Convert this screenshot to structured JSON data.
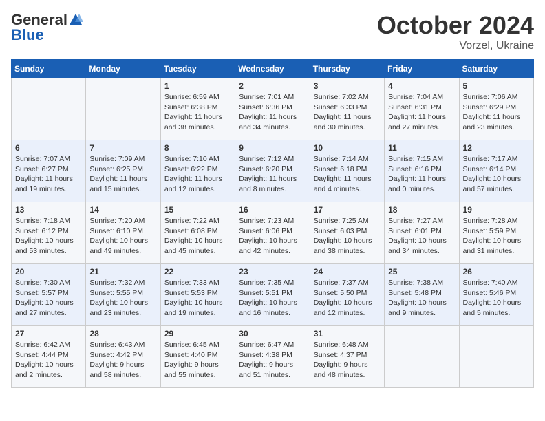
{
  "header": {
    "logo_general": "General",
    "logo_blue": "Blue",
    "month_title": "October 2024",
    "location": "Vorzel, Ukraine"
  },
  "weekdays": [
    "Sunday",
    "Monday",
    "Tuesday",
    "Wednesday",
    "Thursday",
    "Friday",
    "Saturday"
  ],
  "weeks": [
    [
      {
        "day": "",
        "info": ""
      },
      {
        "day": "",
        "info": ""
      },
      {
        "day": "1",
        "info": "Sunrise: 6:59 AM\nSunset: 6:38 PM\nDaylight: 11 hours and 38 minutes."
      },
      {
        "day": "2",
        "info": "Sunrise: 7:01 AM\nSunset: 6:36 PM\nDaylight: 11 hours and 34 minutes."
      },
      {
        "day": "3",
        "info": "Sunrise: 7:02 AM\nSunset: 6:33 PM\nDaylight: 11 hours and 30 minutes."
      },
      {
        "day": "4",
        "info": "Sunrise: 7:04 AM\nSunset: 6:31 PM\nDaylight: 11 hours and 27 minutes."
      },
      {
        "day": "5",
        "info": "Sunrise: 7:06 AM\nSunset: 6:29 PM\nDaylight: 11 hours and 23 minutes."
      }
    ],
    [
      {
        "day": "6",
        "info": "Sunrise: 7:07 AM\nSunset: 6:27 PM\nDaylight: 11 hours and 19 minutes."
      },
      {
        "day": "7",
        "info": "Sunrise: 7:09 AM\nSunset: 6:25 PM\nDaylight: 11 hours and 15 minutes."
      },
      {
        "day": "8",
        "info": "Sunrise: 7:10 AM\nSunset: 6:22 PM\nDaylight: 11 hours and 12 minutes."
      },
      {
        "day": "9",
        "info": "Sunrise: 7:12 AM\nSunset: 6:20 PM\nDaylight: 11 hours and 8 minutes."
      },
      {
        "day": "10",
        "info": "Sunrise: 7:14 AM\nSunset: 6:18 PM\nDaylight: 11 hours and 4 minutes."
      },
      {
        "day": "11",
        "info": "Sunrise: 7:15 AM\nSunset: 6:16 PM\nDaylight: 11 hours and 0 minutes."
      },
      {
        "day": "12",
        "info": "Sunrise: 7:17 AM\nSunset: 6:14 PM\nDaylight: 10 hours and 57 minutes."
      }
    ],
    [
      {
        "day": "13",
        "info": "Sunrise: 7:18 AM\nSunset: 6:12 PM\nDaylight: 10 hours and 53 minutes."
      },
      {
        "day": "14",
        "info": "Sunrise: 7:20 AM\nSunset: 6:10 PM\nDaylight: 10 hours and 49 minutes."
      },
      {
        "day": "15",
        "info": "Sunrise: 7:22 AM\nSunset: 6:08 PM\nDaylight: 10 hours and 45 minutes."
      },
      {
        "day": "16",
        "info": "Sunrise: 7:23 AM\nSunset: 6:06 PM\nDaylight: 10 hours and 42 minutes."
      },
      {
        "day": "17",
        "info": "Sunrise: 7:25 AM\nSunset: 6:03 PM\nDaylight: 10 hours and 38 minutes."
      },
      {
        "day": "18",
        "info": "Sunrise: 7:27 AM\nSunset: 6:01 PM\nDaylight: 10 hours and 34 minutes."
      },
      {
        "day": "19",
        "info": "Sunrise: 7:28 AM\nSunset: 5:59 PM\nDaylight: 10 hours and 31 minutes."
      }
    ],
    [
      {
        "day": "20",
        "info": "Sunrise: 7:30 AM\nSunset: 5:57 PM\nDaylight: 10 hours and 27 minutes."
      },
      {
        "day": "21",
        "info": "Sunrise: 7:32 AM\nSunset: 5:55 PM\nDaylight: 10 hours and 23 minutes."
      },
      {
        "day": "22",
        "info": "Sunrise: 7:33 AM\nSunset: 5:53 PM\nDaylight: 10 hours and 19 minutes."
      },
      {
        "day": "23",
        "info": "Sunrise: 7:35 AM\nSunset: 5:51 PM\nDaylight: 10 hours and 16 minutes."
      },
      {
        "day": "24",
        "info": "Sunrise: 7:37 AM\nSunset: 5:50 PM\nDaylight: 10 hours and 12 minutes."
      },
      {
        "day": "25",
        "info": "Sunrise: 7:38 AM\nSunset: 5:48 PM\nDaylight: 10 hours and 9 minutes."
      },
      {
        "day": "26",
        "info": "Sunrise: 7:40 AM\nSunset: 5:46 PM\nDaylight: 10 hours and 5 minutes."
      }
    ],
    [
      {
        "day": "27",
        "info": "Sunrise: 6:42 AM\nSunset: 4:44 PM\nDaylight: 10 hours and 2 minutes."
      },
      {
        "day": "28",
        "info": "Sunrise: 6:43 AM\nSunset: 4:42 PM\nDaylight: 9 hours and 58 minutes."
      },
      {
        "day": "29",
        "info": "Sunrise: 6:45 AM\nSunset: 4:40 PM\nDaylight: 9 hours and 55 minutes."
      },
      {
        "day": "30",
        "info": "Sunrise: 6:47 AM\nSunset: 4:38 PM\nDaylight: 9 hours and 51 minutes."
      },
      {
        "day": "31",
        "info": "Sunrise: 6:48 AM\nSunset: 4:37 PM\nDaylight: 9 hours and 48 minutes."
      },
      {
        "day": "",
        "info": ""
      },
      {
        "day": "",
        "info": ""
      }
    ]
  ]
}
